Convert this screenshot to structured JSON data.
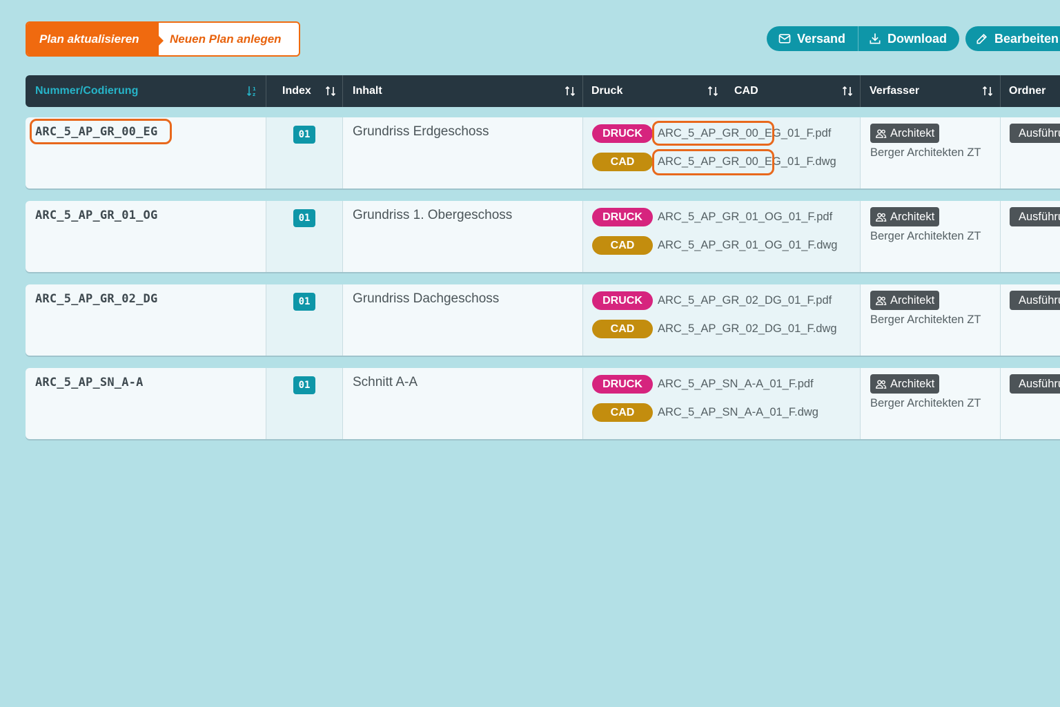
{
  "tabs": {
    "active": "Plan aktualisieren",
    "inactive": "Neuen Plan anlegen"
  },
  "toolbar": {
    "versand": "Versand",
    "download": "Download",
    "edit": "Bearbeiten"
  },
  "columns": {
    "nummer": "Nummer/Codierung",
    "index": "Index",
    "inhalt": "Inhalt",
    "druck": "Druck",
    "cad": "CAD",
    "verfasser": "Verfasser",
    "ordner": "Ordner"
  },
  "labels": {
    "druck": "DRUCK",
    "cad": "CAD"
  },
  "rows": [
    {
      "code": "ARC_5_AP_GR_00_EG",
      "index": "01",
      "inhalt": "Grundriss Erdgeschoss",
      "pdf": "ARC_5_AP_GR_00_EG_01_F.pdf",
      "dwg": "ARC_5_AP_GR_00_EG_01_F.dwg",
      "role": "Architekt",
      "author": "Berger Architekten ZT",
      "folder": "Ausführung"
    },
    {
      "code": "ARC_5_AP_GR_01_OG",
      "index": "01",
      "inhalt": "Grundriss 1. Obergeschoss",
      "pdf": "ARC_5_AP_GR_01_OG_01_F.pdf",
      "dwg": "ARC_5_AP_GR_01_OG_01_F.dwg",
      "role": "Architekt",
      "author": "Berger Architekten ZT",
      "folder": "Ausführung"
    },
    {
      "code": "ARC_5_AP_GR_02_DG",
      "index": "01",
      "inhalt": "Grundriss Dachgeschoss",
      "pdf": "ARC_5_AP_GR_02_DG_01_F.pdf",
      "dwg": "ARC_5_AP_GR_02_DG_01_F.dwg",
      "role": "Architekt",
      "author": "Berger Architekten ZT",
      "folder": "Ausführung"
    },
    {
      "code": "ARC_5_AP_SN_A-A",
      "index": "01",
      "inhalt": "Schnitt A-A",
      "pdf": "ARC_5_AP_SN_A-A_01_F.pdf",
      "dwg": "ARC_5_AP_SN_A-A_01_F.dwg",
      "role": "Architekt",
      "author": "Berger Architekten ZT",
      "folder": "Ausführung"
    }
  ],
  "colors": {
    "accent": "#f06a0f",
    "teal": "#0e96a8",
    "druck": "#d6247e",
    "cad": "#c38d0e",
    "header": "#263640"
  }
}
